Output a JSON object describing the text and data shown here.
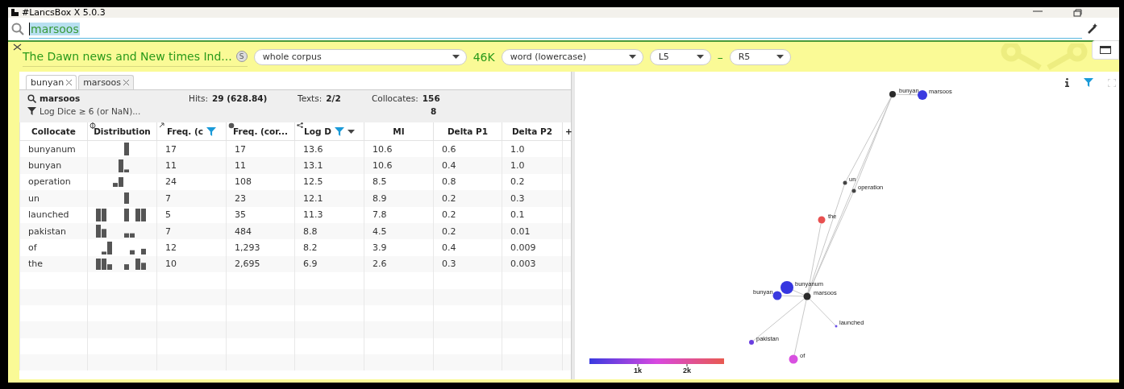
{
  "window": {
    "title": "#LancsBox X 5.0.3"
  },
  "search": {
    "value": "marsoos"
  },
  "toolbar": {
    "corpus": "The Dawn news and New times Ind...",
    "corpus_badge": "S",
    "scope": "whole corpus",
    "size": "46K",
    "unit": "word (lowercase)",
    "left_span": "L5",
    "separator": "–",
    "right_span": "R5"
  },
  "tabs": [
    {
      "label": "bunyan",
      "selected": false
    },
    {
      "label": "marsoos",
      "selected": true
    }
  ],
  "summary": {
    "query": "marsoos",
    "filter": "Log Dice ≥ 6 (or NaN)...",
    "hits_label": "Hits:",
    "hits": "29 (628.84)",
    "texts_label": "Texts:",
    "texts": "2/2",
    "collocates_label": "Collocates:",
    "collocates": "156",
    "collocates_shown": "8"
  },
  "table": {
    "columns": [
      {
        "label": "Collocate",
        "filter": false,
        "sort": false
      },
      {
        "label": "Distribution",
        "filter": false,
        "sort": false
      },
      {
        "label": "Freq. (c",
        "filter": true,
        "sort": false
      },
      {
        "label": "Freq. (cor...",
        "filter": false,
        "sort": false
      },
      {
        "label": "Log D",
        "filter": true,
        "sort": true
      },
      {
        "label": "MI",
        "filter": false,
        "sort": false
      },
      {
        "label": "Delta P1",
        "filter": false,
        "sort": false
      },
      {
        "label": "Delta P2",
        "filter": false,
        "sort": false
      }
    ],
    "add_column": "+",
    "rows": [
      [
        "bunyanum",
        "",
        "17",
        "17",
        "13.6",
        "10.6",
        "0.6",
        "1.0"
      ],
      [
        "bunyan",
        "",
        "11",
        "11",
        "13.1",
        "10.6",
        "0.4",
        "1.0"
      ],
      [
        "operation",
        "",
        "24",
        "108",
        "12.5",
        "8.5",
        "0.8",
        "0.2"
      ],
      [
        "un",
        "",
        "7",
        "23",
        "12.1",
        "8.9",
        "0.2",
        "0.3"
      ],
      [
        "launched",
        "",
        "5",
        "35",
        "11.3",
        "7.8",
        "0.2",
        "0.1"
      ],
      [
        "pakistan",
        "",
        "7",
        "484",
        "8.8",
        "4.5",
        "0.2",
        "0.01"
      ],
      [
        "of",
        "",
        "12",
        "1,293",
        "8.2",
        "3.9",
        "0.4",
        "0.009"
      ],
      [
        "the",
        "",
        "10",
        "2,695",
        "6.9",
        "2.6",
        "0.3",
        "0.003"
      ]
    ]
  },
  "graph": {
    "nodes": [
      {
        "label": "bunyan",
        "color": "#2b2b2b"
      },
      {
        "label": "marsoos",
        "color": "#3a3ae0"
      },
      {
        "label": "un",
        "color": "#444444"
      },
      {
        "label": "operation",
        "color": "#444444"
      },
      {
        "label": "the",
        "color": "#e85050"
      },
      {
        "label": "bunyanum",
        "color": "#3636e0"
      },
      {
        "label": "bunyan",
        "color": "#3a3ae0"
      },
      {
        "label": "marsoos",
        "color": "#2b2b2b"
      },
      {
        "label": "launched",
        "color": "#6a4ee8"
      },
      {
        "label": "pakistan",
        "color": "#6a3ee0"
      },
      {
        "label": "of",
        "color": "#d850e0"
      }
    ],
    "legend_ticks": [
      "1k",
      "2k"
    ]
  }
}
